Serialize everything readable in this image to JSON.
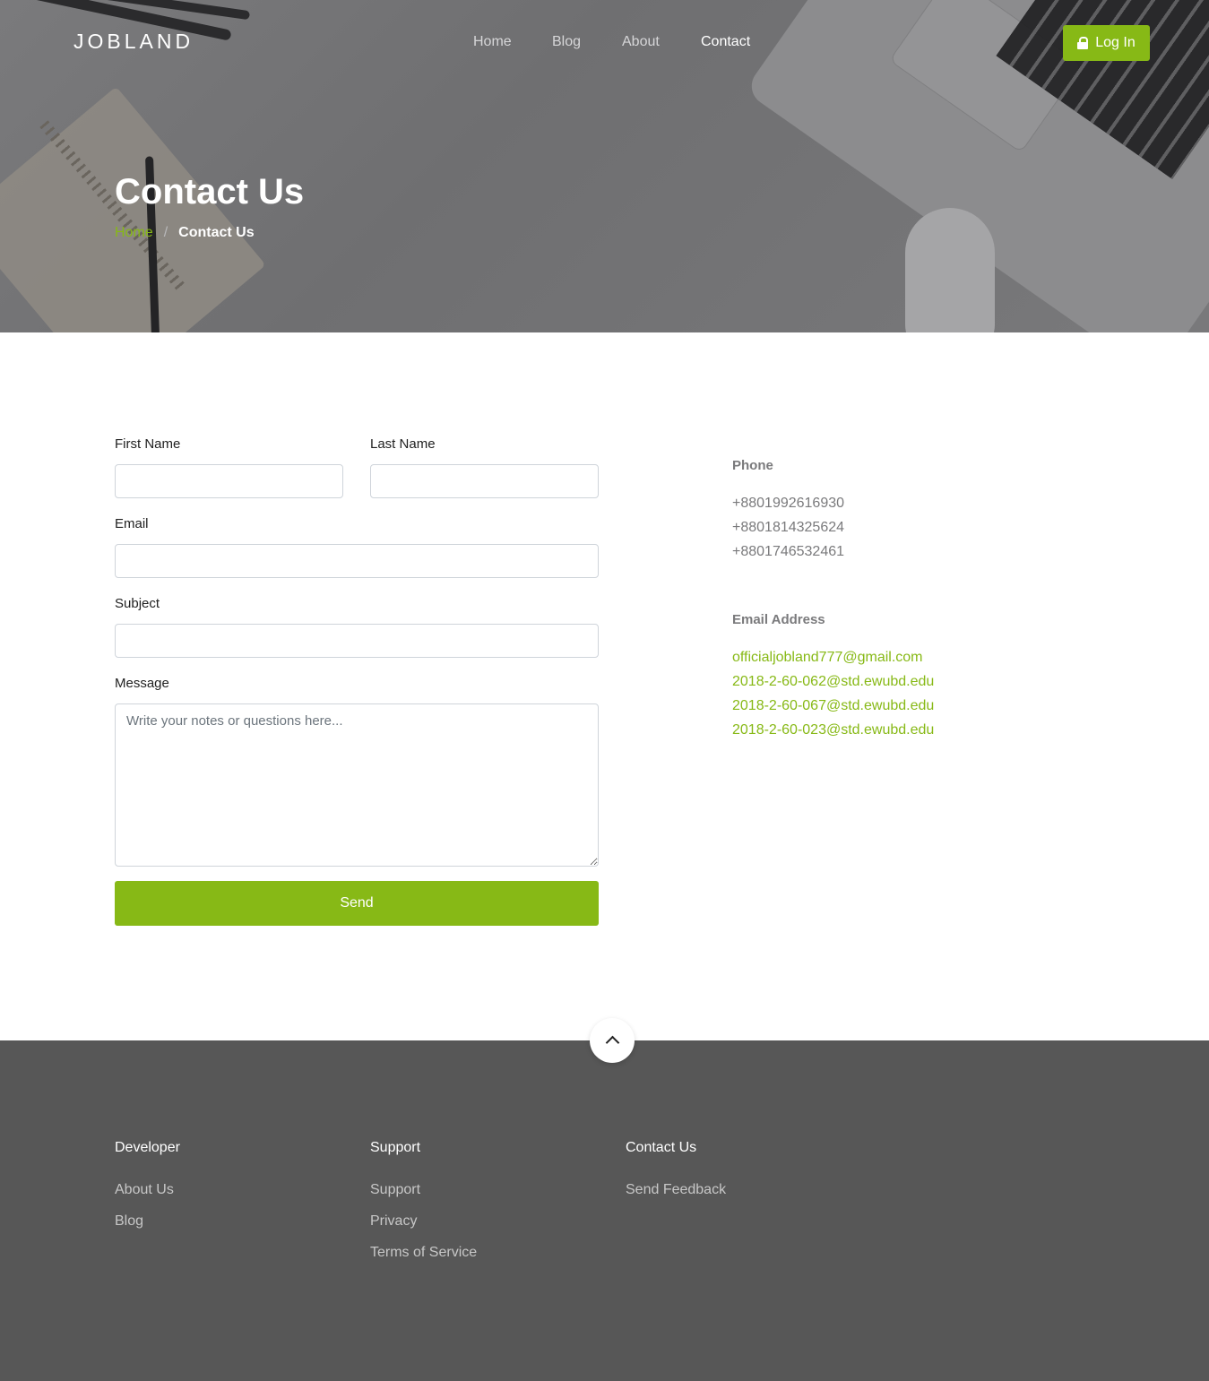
{
  "brand": {
    "logo": "JOBLAND",
    "accent": "#87b916"
  },
  "nav": {
    "items": [
      {
        "label": "Home"
      },
      {
        "label": "Blog"
      },
      {
        "label": "About"
      },
      {
        "label": "Contact"
      }
    ],
    "login_label": "Log In",
    "login_icon": "lock-icon"
  },
  "hero": {
    "title": "Contact Us",
    "breadcrumb": {
      "home": "Home",
      "separator": "/",
      "current": "Contact Us"
    }
  },
  "form": {
    "first_name_label": "First Name",
    "last_name_label": "Last Name",
    "email_label": "Email",
    "subject_label": "Subject",
    "message_label": "Message",
    "message_placeholder": "Write your notes or questions here...",
    "send_label": "Send"
  },
  "contact_info": {
    "phone_heading": "Phone",
    "phones": [
      "+8801992616930",
      "+8801814325624",
      "+8801746532461"
    ],
    "email_heading": "Email Address",
    "emails": [
      "officialjobland777@gmail.com",
      "2018-2-60-062@std.ewubd.edu",
      "2018-2-60-067@std.ewubd.edu",
      "2018-2-60-023@std.ewubd.edu"
    ]
  },
  "footer": {
    "columns": [
      {
        "heading": "Developer",
        "links": [
          "About Us",
          "Blog"
        ]
      },
      {
        "heading": "Support",
        "links": [
          "Support",
          "Privacy",
          "Terms of Service"
        ]
      },
      {
        "heading": "Contact Us",
        "links": [
          "Send Feedback"
        ]
      }
    ],
    "scroll_top_icon": "chevron-up-icon"
  }
}
